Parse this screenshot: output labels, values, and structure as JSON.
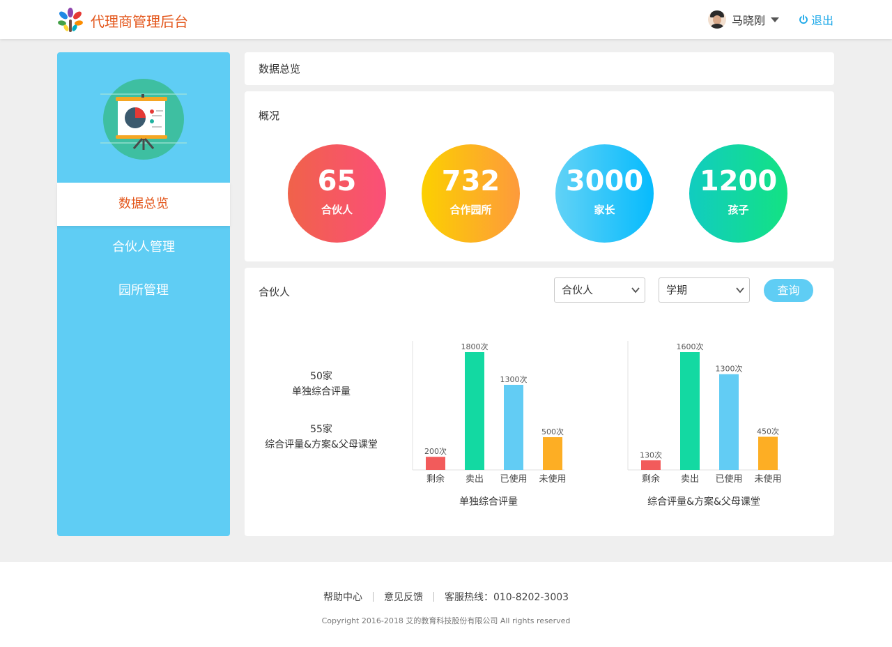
{
  "header": {
    "app_title": "代理商管理后台",
    "user_name": "马晓刚",
    "logout_label": "退出",
    "logo_icon": "colorful-tree-logo-icon",
    "accent_color": "#e3571c",
    "link_color": "#16a6e8"
  },
  "sidebar": {
    "background": "#5fcdf4",
    "illustration_icon": "presentation-board-pie-chart-icon",
    "items": [
      {
        "label": "数据总览",
        "active": true
      },
      {
        "label": "合伙人管理",
        "active": false
      },
      {
        "label": "园所管理",
        "active": false
      }
    ]
  },
  "breadcrumb": {
    "title": "数据总览"
  },
  "overview": {
    "title": "概况",
    "stats": [
      {
        "value": "65",
        "label": "合伙人",
        "gradient": [
          "#f0624a",
          "#fb4f78"
        ]
      },
      {
        "value": "732",
        "label": "合作园所",
        "gradient": [
          "#fcd000",
          "#fd9a3c"
        ]
      },
      {
        "value": "3000",
        "label": "家长",
        "gradient": [
          "#62d2f6",
          "#06bbfd"
        ]
      },
      {
        "value": "1200",
        "label": "孩子",
        "gradient": [
          "#11ccc0",
          "#13e283"
        ]
      }
    ]
  },
  "partner": {
    "title": "合伙人",
    "filter1": "合伙人",
    "filter2": "学期",
    "query_label": "查询",
    "summary": [
      {
        "count": "50家",
        "desc": "单独综合评量"
      },
      {
        "count": "55家",
        "desc": "综合评量&方案&父母课堂"
      }
    ]
  },
  "chart_data": [
    {
      "type": "bar",
      "title": "单独综合评量",
      "categories": [
        "剩余",
        "卖出",
        "已使用",
        "未使用"
      ],
      "values": [
        200,
        1800,
        1300,
        500
      ],
      "data_labels": [
        "200次",
        "1800次",
        "1300次",
        "500次"
      ],
      "colors": [
        "#f25b5b",
        "#13d9a2",
        "#62ccf4",
        "#fdae24"
      ],
      "ylim": [
        0,
        1800
      ]
    },
    {
      "type": "bar",
      "title": "综合评量&方案&父母课堂",
      "categories": [
        "剩余",
        "卖出",
        "已使用",
        "未使用"
      ],
      "values": [
        130,
        1600,
        1300,
        450
      ],
      "data_labels": [
        "130次",
        "1600次",
        "1300次",
        "450次"
      ],
      "colors": [
        "#f25b5b",
        "#13d9a2",
        "#62ccf4",
        "#fdae24"
      ],
      "ylim": [
        0,
        1600
      ]
    }
  ],
  "footer": {
    "links": [
      "帮助中心",
      "意见反馈",
      "客服热线：010-8202-3003"
    ],
    "copyright": "Copyright 2016-2018 艾的教育科技股份有限公司 All rights reserved"
  }
}
